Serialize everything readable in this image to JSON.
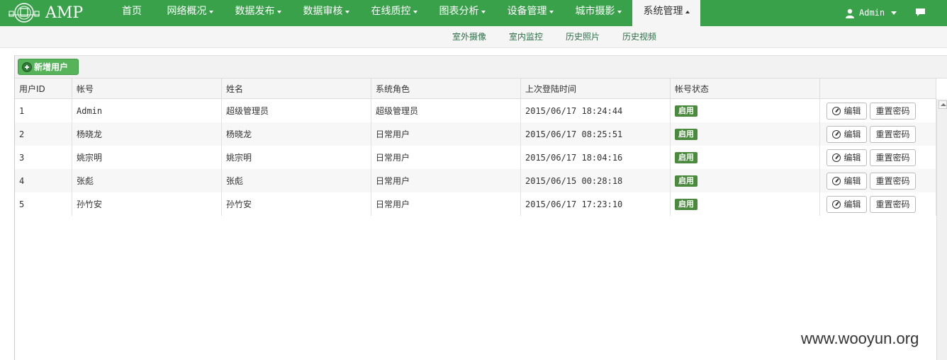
{
  "brand": {
    "logo_text": "AMP"
  },
  "nav": {
    "items": [
      {
        "label": "首页",
        "has_caret": false,
        "active": false
      },
      {
        "label": "网络概况",
        "has_caret": true,
        "active": false
      },
      {
        "label": "数据发布",
        "has_caret": true,
        "active": false
      },
      {
        "label": "数据审核",
        "has_caret": true,
        "active": false
      },
      {
        "label": "在线质控",
        "has_caret": true,
        "active": false
      },
      {
        "label": "图表分析",
        "has_caret": true,
        "active": false
      },
      {
        "label": "设备管理",
        "has_caret": true,
        "active": false
      },
      {
        "label": "城市摄影",
        "has_caret": true,
        "active": false
      },
      {
        "label": "系统管理",
        "has_caret": true,
        "active": true
      }
    ],
    "user": "Admin"
  },
  "subnav": {
    "items": [
      "室外摄像",
      "室内监控",
      "历史照片",
      "历史视频"
    ]
  },
  "toolbar": {
    "add_user": "新增用户"
  },
  "table": {
    "headers": [
      "用户ID",
      "帐号",
      "姓名",
      "系统角色",
      "上次登陆时间",
      "帐号状态",
      ""
    ],
    "rows": [
      {
        "id": "1",
        "account": "Admin",
        "name": "超级管理员",
        "role": "超级管理员",
        "last_login": "2015/06/17 18:24:44",
        "status": "启用"
      },
      {
        "id": "2",
        "account": "杨晓龙",
        "name": "杨晓龙",
        "role": "日常用户",
        "last_login": "2015/06/17 08:25:51",
        "status": "启用"
      },
      {
        "id": "3",
        "account": "姚宗明",
        "name": "姚宗明",
        "role": "日常用户",
        "last_login": "2015/06/17 18:04:16",
        "status": "启用"
      },
      {
        "id": "4",
        "account": "张彪",
        "name": "张彪",
        "role": "日常用户",
        "last_login": "2015/06/15 00:28:18",
        "status": "启用"
      },
      {
        "id": "5",
        "account": "孙竹安",
        "name": "孙竹安",
        "role": "日常用户",
        "last_login": "2015/06/17 17:23:10",
        "status": "启用"
      }
    ],
    "actions": {
      "edit": "编辑",
      "reset_password": "重置密码"
    }
  },
  "watermark": "www.wooyun.org",
  "colors": {
    "topbar": "#3aa14b",
    "status_green": "#4a8a3c",
    "add_button": "#57b359",
    "subnav_text": "#2d6e48"
  }
}
